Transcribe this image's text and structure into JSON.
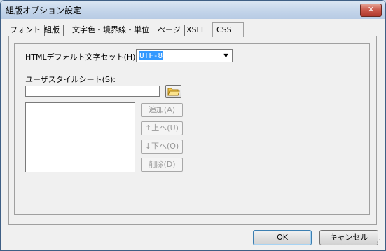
{
  "window": {
    "title": "組版オプション設定",
    "close_label": "✕"
  },
  "tabs": [
    {
      "label": "フォント"
    },
    {
      "label": "組版"
    },
    {
      "label": "文字色・境界線・単位"
    },
    {
      "label": "ページ"
    },
    {
      "label": "XSLT"
    },
    {
      "label": "CSS"
    }
  ],
  "active_tab": "CSS",
  "charset": {
    "label": "HTMLデフォルト文字セット(H):",
    "value": "UTF-8"
  },
  "stylesheet": {
    "label": "ユーザスタイルシート(S):",
    "input_value": "",
    "list_items": [],
    "add_label": "追加(A)",
    "up_label": "↑上へ(U)",
    "down_label": "↓下へ(O)",
    "delete_label": "削除(D)"
  },
  "footer": {
    "ok_label": "OK",
    "cancel_label": "キャンセル"
  }
}
